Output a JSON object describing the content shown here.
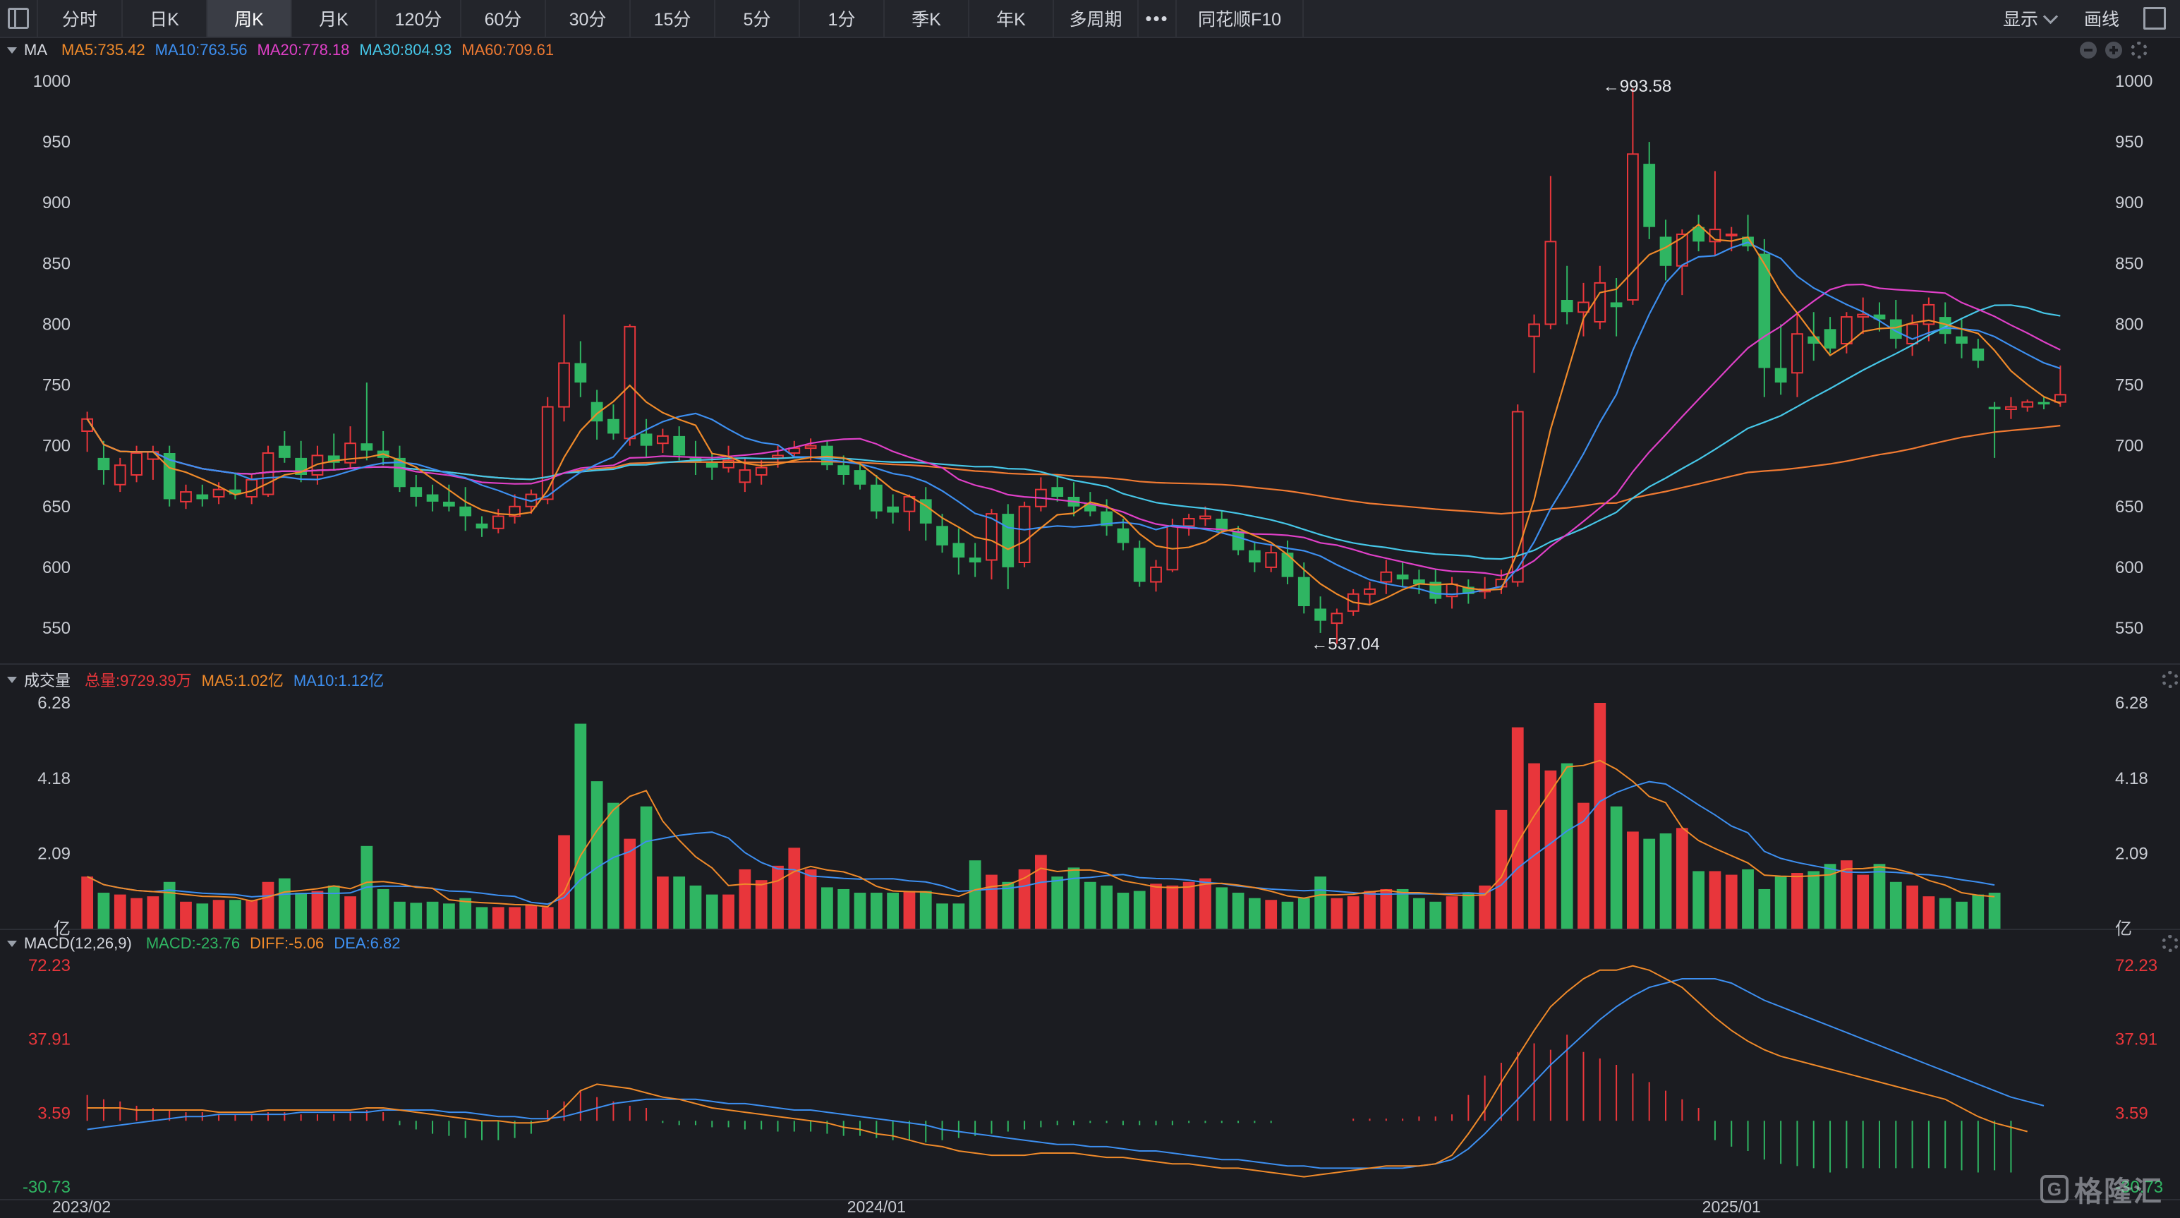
{
  "toolbar": {
    "tabs": [
      "分时",
      "日K",
      "周K",
      "月K",
      "120分",
      "60分",
      "30分",
      "15分",
      "5分",
      "1分",
      "季K",
      "年K",
      "多周期"
    ],
    "active": "周K",
    "more": "•••",
    "f10": "同花顺F10",
    "show_label": "显示",
    "draw_label": "画线"
  },
  "colors": {
    "up": "#e8363b",
    "down": "#2fb562",
    "ma5": "#f08a2a",
    "ma10": "#3d8ff0",
    "ma20": "#e040c8",
    "ma30": "#46c7e8",
    "ma60": "#f07a32"
  },
  "price_panel": {
    "name": "MA",
    "legend": [
      {
        "text": "MA5:735.42",
        "color": "#f08a2a"
      },
      {
        "text": "MA10:763.56",
        "color": "#3d8ff0"
      },
      {
        "text": "MA20:778.18",
        "color": "#e040c8"
      },
      {
        "text": "MA30:804.93",
        "color": "#46c7e8"
      },
      {
        "text": "MA60:709.61",
        "color": "#f07a32"
      }
    ],
    "y_ticks": [
      "1000",
      "950",
      "900",
      "850",
      "800",
      "750",
      "700",
      "650",
      "600",
      "550"
    ],
    "max_label": "←993.58",
    "min_label": "←537.04"
  },
  "volume_panel": {
    "name": "成交量",
    "legend": [
      {
        "text": "总量:9729.39万",
        "color": "#e8363b"
      },
      {
        "text": "MA5:1.02亿",
        "color": "#f08a2a"
      },
      {
        "text": "MA10:1.12亿",
        "color": "#3d8ff0"
      }
    ],
    "y_ticks": [
      "6.28",
      "4.18",
      "2.09",
      "亿"
    ]
  },
  "macd_panel": {
    "name": "MACD(12,26,9)",
    "legend": [
      {
        "text": "MACD:-23.76",
        "color": "#2fb562"
      },
      {
        "text": "DIFF:-5.06",
        "color": "#f08a2a"
      },
      {
        "text": "DEA:6.82",
        "color": "#3d8ff0"
      }
    ],
    "y_ticks": [
      "72.23",
      "37.91",
      "3.59",
      "-30.73"
    ]
  },
  "x_labels": [
    "2023/02",
    "2024/01",
    "2025/01"
  ],
  "watermark": {
    "logo": "G",
    "text": "格隆汇"
  },
  "chart_data": {
    "type": "candlestick",
    "title": "",
    "period": "周K",
    "price_axis": {
      "ylim": [
        537,
        1000
      ],
      "ticks": [
        1000,
        950,
        900,
        850,
        800,
        750,
        700,
        650,
        600,
        550
      ]
    },
    "volume_axis": {
      "unit": "亿",
      "ylim": [
        0,
        6.28
      ],
      "ticks": [
        6.28,
        4.18,
        2.09
      ]
    },
    "macd_axis": {
      "ylim": [
        -30.73,
        72.23
      ],
      "ticks": [
        72.23,
        37.91,
        3.59,
        -30.73
      ]
    },
    "x_ticks": [
      {
        "index": 0,
        "label": "2023/02"
      },
      {
        "index": 48,
        "label": "2024/01"
      },
      {
        "index": 100,
        "label": "2025/01"
      }
    ],
    "extremes": {
      "high": 993.58,
      "high_index": 92,
      "low": 537.04,
      "low_index": 74
    },
    "candles": [
      [
        712,
        728,
        695,
        722
      ],
      [
        690,
        704,
        668,
        680
      ],
      [
        668,
        690,
        662,
        684
      ],
      [
        676,
        700,
        670,
        694
      ],
      [
        689,
        700,
        672,
        695
      ],
      [
        694,
        700,
        650,
        656
      ],
      [
        654,
        668,
        648,
        662
      ],
      [
        660,
        668,
        650,
        656
      ],
      [
        658,
        670,
        652,
        664
      ],
      [
        664,
        678,
        656,
        660
      ],
      [
        658,
        676,
        652,
        672
      ],
      [
        660,
        700,
        658,
        694
      ],
      [
        700,
        712,
        686,
        690
      ],
      [
        690,
        704,
        670,
        676
      ],
      [
        676,
        700,
        668,
        692
      ],
      [
        692,
        710,
        680,
        686
      ],
      [
        686,
        716,
        682,
        702
      ],
      [
        702,
        752,
        688,
        696
      ],
      [
        696,
        712,
        684,
        690
      ],
      [
        690,
        700,
        662,
        666
      ],
      [
        666,
        676,
        650,
        658
      ],
      [
        660,
        668,
        646,
        654
      ],
      [
        654,
        668,
        646,
        650
      ],
      [
        650,
        666,
        630,
        642
      ],
      [
        636,
        642,
        625,
        632
      ],
      [
        632,
        648,
        628,
        642
      ],
      [
        642,
        660,
        636,
        650
      ],
      [
        650,
        664,
        644,
        660
      ],
      [
        656,
        740,
        652,
        732
      ],
      [
        732,
        808,
        720,
        768
      ],
      [
        768,
        786,
        740,
        752
      ],
      [
        736,
        746,
        705,
        720
      ],
      [
        722,
        734,
        705,
        710
      ],
      [
        706,
        800,
        700,
        798
      ],
      [
        710,
        722,
        690,
        700
      ],
      [
        702,
        714,
        694,
        708
      ],
      [
        708,
        716,
        688,
        692
      ],
      [
        690,
        704,
        676,
        686
      ],
      [
        686,
        694,
        672,
        682
      ],
      [
        682,
        700,
        678,
        688
      ],
      [
        670,
        690,
        662,
        680
      ],
      [
        676,
        688,
        668,
        682
      ],
      [
        690,
        700,
        682,
        692
      ],
      [
        694,
        704,
        690,
        698
      ],
      [
        698,
        706,
        688,
        700
      ],
      [
        700,
        704,
        680,
        684
      ],
      [
        684,
        692,
        668,
        676
      ],
      [
        680,
        686,
        664,
        668
      ],
      [
        668,
        676,
        640,
        646
      ],
      [
        650,
        660,
        636,
        645
      ],
      [
        646,
        660,
        630,
        658
      ],
      [
        656,
        666,
        622,
        636
      ],
      [
        634,
        644,
        612,
        618
      ],
      [
        620,
        632,
        594,
        608
      ],
      [
        608,
        620,
        592,
        604
      ],
      [
        606,
        648,
        590,
        644
      ],
      [
        644,
        652,
        582,
        600
      ],
      [
        604,
        654,
        600,
        650
      ],
      [
        650,
        674,
        646,
        664
      ],
      [
        666,
        676,
        654,
        658
      ],
      [
        658,
        670,
        642,
        650
      ],
      [
        652,
        662,
        642,
        646
      ],
      [
        646,
        656,
        626,
        634
      ],
      [
        632,
        640,
        614,
        620
      ],
      [
        616,
        622,
        584,
        588
      ],
      [
        588,
        606,
        580,
        600
      ],
      [
        598,
        640,
        596,
        634
      ],
      [
        634,
        644,
        626,
        640
      ],
      [
        640,
        650,
        634,
        642
      ],
      [
        640,
        646,
        628,
        630
      ],
      [
        630,
        634,
        610,
        614
      ],
      [
        614,
        620,
        596,
        604
      ],
      [
        600,
        618,
        596,
        612
      ],
      [
        612,
        622,
        586,
        592
      ],
      [
        592,
        604,
        562,
        568
      ],
      [
        566,
        576,
        546,
        556
      ],
      [
        554,
        566,
        537,
        562
      ],
      [
        564,
        582,
        560,
        578
      ],
      [
        578,
        588,
        570,
        582
      ],
      [
        588,
        606,
        578,
        596
      ],
      [
        594,
        604,
        584,
        590
      ],
      [
        590,
        598,
        578,
        586
      ],
      [
        588,
        598,
        570,
        574
      ],
      [
        576,
        592,
        566,
        586
      ],
      [
        584,
        590,
        570,
        578
      ],
      [
        580,
        592,
        574,
        582
      ],
      [
        584,
        598,
        578,
        590
      ],
      [
        588,
        734,
        584,
        728
      ],
      [
        790,
        808,
        760,
        800
      ],
      [
        800,
        922,
        796,
        868
      ],
      [
        820,
        848,
        800,
        810
      ],
      [
        810,
        834,
        790,
        818
      ],
      [
        802,
        848,
        796,
        834
      ],
      [
        818,
        838,
        790,
        814
      ],
      [
        820,
        994,
        816,
        940
      ],
      [
        932,
        950,
        870,
        880
      ],
      [
        872,
        886,
        836,
        848
      ],
      [
        848,
        878,
        824,
        874
      ],
      [
        880,
        890,
        860,
        868
      ],
      [
        868,
        926,
        856,
        878
      ],
      [
        874,
        880,
        860,
        874
      ],
      [
        872,
        890,
        860,
        864
      ],
      [
        858,
        870,
        740,
        764
      ],
      [
        764,
        800,
        742,
        752
      ],
      [
        760,
        810,
        740,
        792
      ],
      [
        790,
        810,
        770,
        784
      ],
      [
        796,
        806,
        776,
        780
      ],
      [
        784,
        810,
        776,
        806
      ],
      [
        806,
        822,
        792,
        808
      ],
      [
        808,
        818,
        794,
        804
      ],
      [
        804,
        820,
        780,
        788
      ],
      [
        784,
        808,
        774,
        800
      ],
      [
        800,
        822,
        786,
        816
      ],
      [
        806,
        818,
        784,
        792
      ],
      [
        790,
        804,
        772,
        784
      ],
      [
        780,
        788,
        764,
        770
      ],
      [
        732,
        736,
        690,
        730
      ],
      [
        730,
        740,
        722,
        732
      ],
      [
        732,
        738,
        728,
        736
      ],
      [
        736,
        740,
        730,
        734
      ],
      [
        736,
        766,
        732,
        742
      ]
    ],
    "volumes": [
      1.45,
      1.0,
      0.95,
      0.85,
      0.9,
      1.3,
      0.75,
      0.7,
      0.8,
      0.8,
      0.8,
      1.3,
      1.4,
      1.0,
      1.05,
      1.2,
      0.9,
      2.3,
      1.1,
      0.75,
      0.72,
      0.75,
      0.7,
      0.85,
      0.6,
      0.6,
      0.6,
      0.65,
      0.6,
      2.6,
      5.7,
      4.1,
      3.5,
      2.5,
      3.4,
      1.45,
      1.45,
      1.2,
      0.95,
      0.95,
      1.65,
      1.35,
      1.75,
      2.25,
      1.65,
      1.15,
      1.1,
      1.0,
      1.0,
      1.0,
      1.05,
      1.05,
      0.7,
      0.7,
      1.9,
      1.5,
      1.3,
      1.65,
      2.05,
      1.45,
      1.7,
      1.3,
      1.2,
      1.0,
      1.05,
      1.25,
      1.2,
      1.3,
      1.4,
      1.15,
      1.0,
      0.85,
      0.8,
      0.75,
      0.85,
      1.45,
      0.85,
      0.9,
      1.05,
      1.1,
      1.1,
      0.85,
      0.75,
      0.9,
      1.0,
      1.2,
      3.3,
      5.6,
      4.6,
      4.4,
      4.6,
      3.5,
      6.28,
      3.4,
      2.7,
      2.5,
      2.65,
      2.8,
      1.6,
      1.6,
      1.5,
      1.65,
      1.1,
      1.45,
      1.55,
      1.6,
      1.8,
      1.9,
      1.5,
      1.8,
      1.3,
      1.2,
      0.9,
      0.85,
      0.75,
      0.95,
      1.0
    ],
    "macd_hist": [
      12,
      10,
      9,
      7,
      6,
      5,
      4,
      4,
      3,
      3,
      3,
      4,
      4,
      3,
      3,
      3,
      4,
      5,
      4,
      -2,
      -4,
      -6,
      -7,
      -8,
      -9,
      -9,
      -8,
      -6,
      5,
      9,
      14,
      11,
      9,
      7,
      6,
      -1,
      -2,
      -2,
      -3,
      -3,
      -4,
      -4,
      -5,
      -5,
      -5,
      -6,
      -7,
      -7,
      -8,
      -9,
      -9,
      -10,
      -9,
      -8,
      -7,
      -6,
      -5,
      -4,
      -3,
      -2,
      -2,
      -1,
      -1,
      -2,
      -2,
      -2,
      -2,
      -1,
      -1,
      -1,
      -1,
      -1,
      -1,
      0,
      0,
      0,
      0,
      1,
      1,
      1,
      1,
      2,
      2,
      3,
      12,
      21,
      27,
      32,
      36,
      33,
      40,
      32,
      29,
      26,
      22,
      18,
      14,
      10,
      6,
      -9,
      -12,
      -14,
      -18,
      -20,
      -21,
      -22,
      -24,
      -22,
      -22,
      -22,
      -22,
      -22,
      -22,
      -22,
      -23,
      -24,
      -23,
      -24
    ],
    "macd_diff": [
      6,
      6,
      6,
      5,
      5,
      5,
      5,
      5,
      4,
      4,
      4,
      5,
      5,
      5,
      5,
      5,
      5,
      6,
      6,
      5,
      4,
      3,
      2,
      1,
      0,
      0,
      -1,
      -1,
      0,
      6,
      14,
      17,
      16,
      15,
      13,
      11,
      10,
      8,
      6,
      5,
      4,
      3,
      2,
      1,
      0,
      -1,
      -3,
      -4,
      -6,
      -7,
      -9,
      -11,
      -12,
      -14,
      -15,
      -16,
      -16,
      -16,
      -15,
      -15,
      -15,
      -16,
      -17,
      -17,
      -18,
      -19,
      -20,
      -20,
      -21,
      -22,
      -22,
      -23,
      -24,
      -25,
      -26,
      -25,
      -24,
      -23,
      -22,
      -21,
      -21,
      -21,
      -20,
      -16,
      -6,
      5,
      18,
      30,
      42,
      53,
      60,
      66,
      70,
      70,
      72,
      70,
      66,
      62,
      55,
      48,
      42,
      37,
      33,
      30,
      28,
      26,
      24,
      22,
      20,
      18,
      16,
      14,
      12,
      10,
      6,
      2,
      -1,
      -3,
      -5
    ],
    "macd_dea": [
      -4,
      -3,
      -2,
      -1,
      0,
      1,
      2,
      2,
      3,
      3,
      3,
      3,
      3,
      4,
      4,
      4,
      4,
      4,
      5,
      5,
      5,
      5,
      4,
      4,
      3,
      2,
      2,
      1,
      1,
      2,
      4,
      6,
      8,
      9,
      10,
      10,
      10,
      10,
      9,
      8,
      8,
      7,
      6,
      5,
      5,
      4,
      3,
      2,
      1,
      0,
      -1,
      -2,
      -4,
      -5,
      -6,
      -7,
      -8,
      -9,
      -10,
      -11,
      -11,
      -12,
      -12,
      -13,
      -14,
      -14,
      -15,
      -16,
      -17,
      -18,
      -18,
      -19,
      -20,
      -21,
      -21,
      -22,
      -22,
      -22,
      -22,
      -22,
      -22,
      -21,
      -20,
      -18,
      -13,
      -6,
      2,
      10,
      18,
      26,
      33,
      40,
      47,
      53,
      58,
      62,
      64,
      66,
      66,
      66,
      64,
      60,
      56,
      53,
      50,
      47,
      44,
      41,
      38,
      35,
      32,
      29,
      26,
      23,
      20,
      17,
      14,
      11,
      9,
      7
    ]
  }
}
